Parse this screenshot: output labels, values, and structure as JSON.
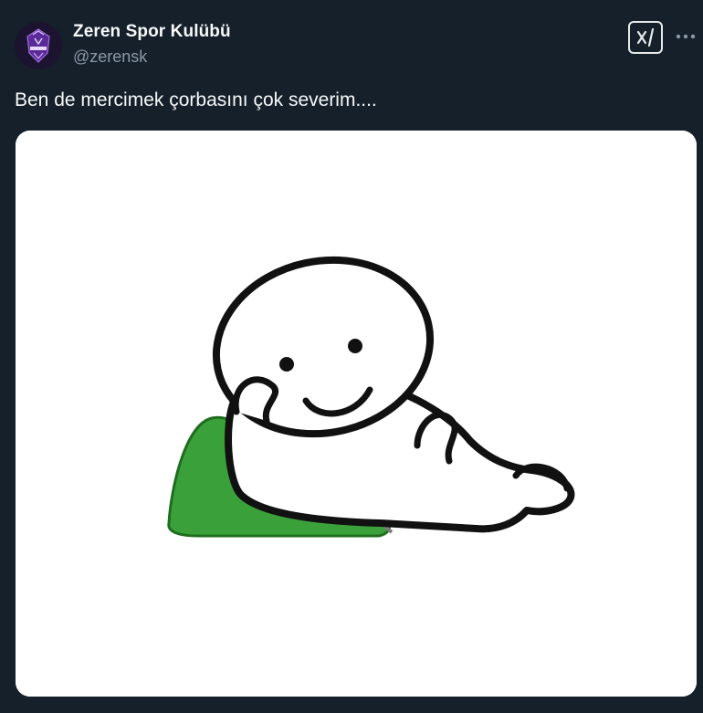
{
  "author": {
    "display_name": "Zeren Spor Kulübü",
    "handle": "@zerensk",
    "avatar_icon": "zeren-spor-logo-icon",
    "avatar_bg": "#1c1330",
    "avatar_accent": "#7b3fbf"
  },
  "actions": {
    "grok_icon": "grok-icon",
    "more_icon": "more-horizontal-icon"
  },
  "tweet": {
    "text": "Ben de mercimek çorbasını çok severim...."
  },
  "media": {
    "type": "meme-image",
    "description_icon": "smiling-cartoon-character-lying-on-green-pillow",
    "pillow_color": "#3aa13a",
    "background": "#ffffff"
  },
  "theme": {
    "background": "#15202b",
    "text_primary": "#f7f9f9",
    "text_secondary": "#8b98a5"
  }
}
